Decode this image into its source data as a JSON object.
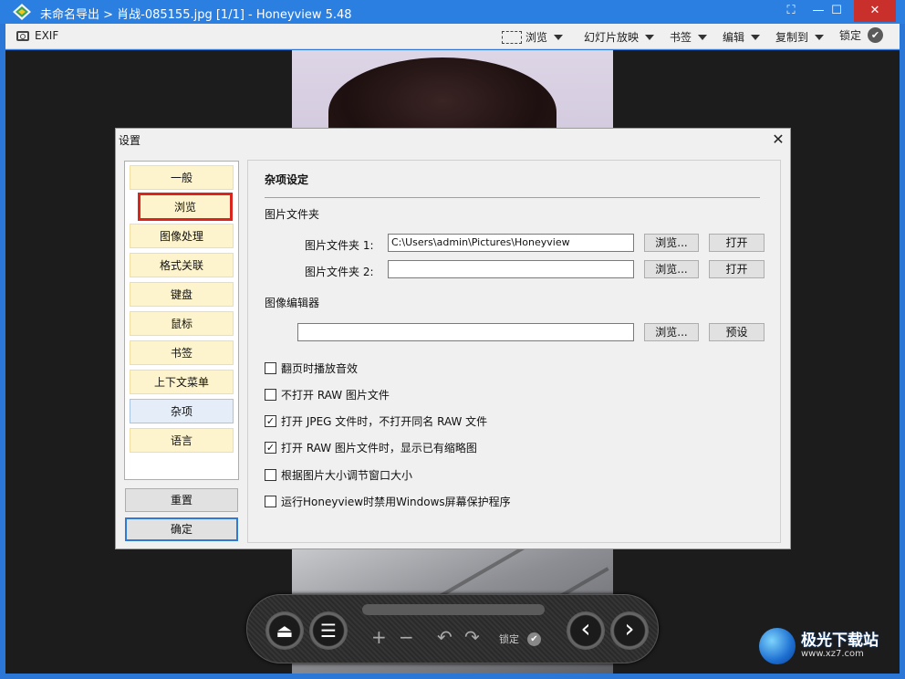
{
  "window": {
    "title": "未命名导出 > 肖战-085155.jpg [1/1] - Honeyview 5.48",
    "controls": {
      "fullscreen": "⛶",
      "minimize": "—",
      "maximize": "☐",
      "close": "✕"
    }
  },
  "toolbar": {
    "exif": "EXIF",
    "browse": "浏览",
    "slideshow": "幻灯片放映",
    "bookmark": "书签",
    "edit": "编辑",
    "copy_to": "复制到",
    "lock": "锁定",
    "lock_check": "✔"
  },
  "controlbar": {
    "eject": "⏏",
    "menu": "☰",
    "zoom_in": "+",
    "zoom_out": "−",
    "rotate_left": "↶",
    "rotate_right": "↷",
    "lock": "锁定",
    "lock_check": "✔",
    "prev": "‹",
    "next": "›"
  },
  "watermark": {
    "name": "极光下载站",
    "url": "www.xz7.com"
  },
  "dialog": {
    "title": "设置",
    "close": "✕",
    "nav": [
      {
        "label": "一般"
      },
      {
        "label": "浏览"
      },
      {
        "label": "图像处理"
      },
      {
        "label": "格式关联"
      },
      {
        "label": "键盘"
      },
      {
        "label": "鼠标"
      },
      {
        "label": "书签"
      },
      {
        "label": "上下文菜单"
      },
      {
        "label": "杂项"
      },
      {
        "label": "语言"
      }
    ],
    "active_nav": "杂项",
    "reset": "重置",
    "ok": "确定",
    "content": {
      "section_title": "杂项设定",
      "folders_group": "图片文件夹",
      "folder1_label": "图片文件夹 1:",
      "folder1_value": "C:\\Users\\admin\\Pictures\\Honeyview",
      "folder2_label": "图片文件夹 2:",
      "folder2_value": "",
      "browse": "浏览...",
      "open": "打开",
      "editor_group": "图像编辑器",
      "editor_value": "",
      "preset": "预设",
      "options": [
        {
          "label": "翻页时播放音效",
          "checked": false
        },
        {
          "label": "不打开 RAW 图片文件",
          "checked": false
        },
        {
          "label": "打开 JPEG 文件时，不打开同名 RAW 文件",
          "checked": true
        },
        {
          "label": "打开 RAW 图片文件时，显示已有缩略图",
          "checked": true
        },
        {
          "label": "根据图片大小调节窗口大小",
          "checked": false
        },
        {
          "label": "运行Honeyview时禁用Windows屏幕保护程序",
          "checked": false
        }
      ]
    }
  }
}
